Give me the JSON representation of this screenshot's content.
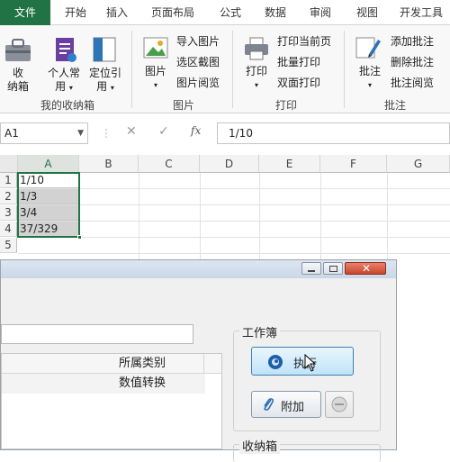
{
  "ribbon_tabs": [
    "文件",
    "开始",
    "插入",
    "页面布局",
    "公式",
    "数据",
    "审阅",
    "视图",
    "开发工具"
  ],
  "groups": {
    "favorites": {
      "label": "我的收纳箱",
      "btn1": "收",
      "btn1b": "纳箱",
      "btn2": "个人常",
      "btn2b": "用",
      "btn3": "定位引",
      "btn3b": "用"
    },
    "picture": {
      "label": "图片",
      "big": "图片",
      "items": [
        "导入图片",
        "选区截图",
        "图片阅览"
      ]
    },
    "print": {
      "label": "打印",
      "big": "打印",
      "items": [
        "打印当前页",
        "批量打印",
        "双面打印"
      ]
    },
    "comment": {
      "label": "批注",
      "big": "批注",
      "items": [
        "添加批注",
        "删除批注",
        "批注阅览"
      ]
    }
  },
  "formula_bar": {
    "name_box": "A1",
    "fx": "fx",
    "content": "1/10",
    "cancel": "✕",
    "confirm": "✓"
  },
  "sheet": {
    "columns": [
      "A",
      "B",
      "C",
      "D",
      "E",
      "F",
      "G"
    ],
    "rows": [
      "1",
      "2",
      "3",
      "4",
      "5"
    ],
    "cells": [
      "1/10",
      "1/3",
      "3/4",
      "37/329"
    ]
  },
  "dialog": {
    "list_header": "所属类别",
    "list_row": "数值转换",
    "workbook_group": "工作簿",
    "execute_button": "执行",
    "attach_button": "附加",
    "storage_group": "收纳箱"
  },
  "colors": {
    "excel_green": "#217346",
    "selection_border": "#217346",
    "dialog_bg": "#f0f0f0"
  }
}
